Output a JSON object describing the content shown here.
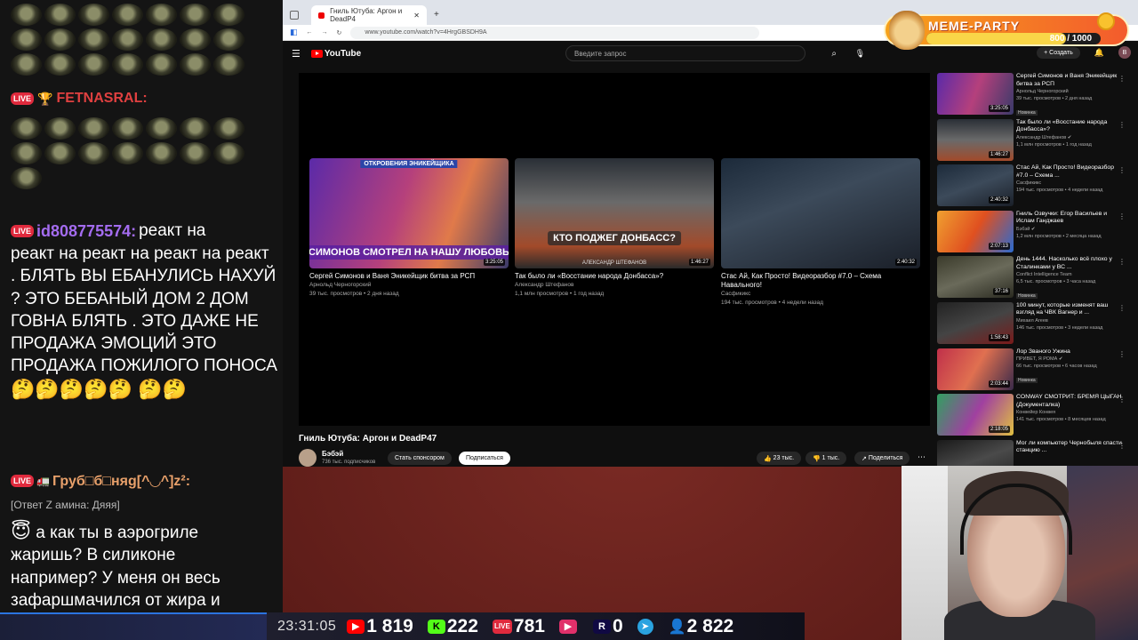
{
  "chat": {
    "messages": [
      {
        "user": "FETNASRAL:",
        "badge": "LIVE"
      },
      {
        "user": "id808775574:",
        "badge": "LIVE",
        "text_first": " реакт на",
        "text": "реакт на реакт на реакт на реакт . БЛЯТЬ ВЫ ЕБАНУЛИСЬ НАХУЙ ? ЭТО БЕБАНЫЙ ДОМ 2 ДОМ ГОВНА БЛЯТЬ . ЭТО ДАЖЕ НЕ ПРОДАЖА ЭМОЦИЙ ЭТО ПРОДАЖА ПОЖИЛОГО ПОНОСА"
      },
      {
        "user": "Груб□б□няg[^◡^]z²:",
        "badge": "LIVE",
        "reply_ref": "[Ответ Z амина: Дяяя]",
        "text": "а как ты в аэрогриле жаришь? В силиконе например? У меня он весь зафаршмачился от жира и пятна неотмываемые"
      }
    ]
  },
  "browser": {
    "tab_title": "Гниль Ютуба: Аргон и DeadP4",
    "url": "www.youtube.com/watch?v=4HrgGBSDH9A",
    "yt": {
      "logo": "YouTube",
      "search_placeholder": "Введите запрос",
      "create_label": "Создать",
      "avatar_letter": "В"
    },
    "endscreen": [
      {
        "title": "Сергей Симонов и Ваня Эникейщик битва за РСП",
        "channel": "Арнольд Черногорский",
        "meta": "39 тыс. просмотров • 2 дня назад",
        "duration": "3:25:05",
        "overlay_top": "ОТКРОВЕНИЯ ЭНИКЕЙЩИКА",
        "overlay": "СИМОНОВ СМОТРЕЛ НА НАШУ ЛЮБОВЬ"
      },
      {
        "title": "Так было ли «Восстание народа Донбасса»?",
        "channel": "Александр Штефанов",
        "meta": "1,1 млн просмотров • 1 год назад",
        "duration": "1:46:27",
        "overlay": "КТО ПОДЖЕГ ДОНБАСС?",
        "overlay_bottom": "АЛЕКСАНДР ШТЕФАНОВ"
      },
      {
        "title": "Стас Ай, Как Просто! Видеоразбор #7.0 – Схема Навального!",
        "channel": "Сасфикикс",
        "meta": "194 тыс. просмотров • 4 недели назад",
        "duration": "2:40:32"
      }
    ],
    "video": {
      "title": "Гниль Ютуба: Аргон и DeadP47",
      "channel": "Бэбэй",
      "subs": "736 тыс. подписчиков",
      "sponsor_label": "Стать спонсором",
      "subscribe_label": "Подписаться",
      "likes": "23 тыс.",
      "dislikes": "1 тыс.",
      "share_label": "Поделиться"
    },
    "sidebar": [
      {
        "title": "Сергей Симонов и Ваня Эникейщик битва за РСП",
        "channel": "Арнольд Черногорский",
        "views": "39 тыс. просмотров • 2 дня назад",
        "duration": "3:25:05",
        "badge": "Новинка"
      },
      {
        "title": "Так было ли «Восстание народа Донбасса»?",
        "channel": "Александр Штефанов ✔",
        "views": "1,1 млн просмотров • 1 год назад",
        "duration": "1:46:27"
      },
      {
        "title": "Стас Ай, Как Просто! Видеоразбор #7.0 – Схема ...",
        "channel": "Сасфикикс",
        "views": "194 тыс. просмотров • 4 недели назад",
        "duration": "2:40:32"
      },
      {
        "title": "Гниль Озвучки: Егор Васильев и Ислам Ганджаев",
        "channel": "Бэбэй ✔",
        "views": "1,2 млн просмотров • 2 месяца назад",
        "duration": "2:07:13"
      },
      {
        "title": "День 1444. Насколько всё плохо у Сталинками у ВС ...",
        "channel": "Conflict Intelligence Team",
        "views": "6,5 тыс. просмотров • 3 часа назад",
        "duration": "37:16",
        "badge": "Новинка"
      },
      {
        "title": "100 минут, которые изменят ваш взгляд на ЧВК Вагнер и ...",
        "channel": "Михаил Агеев",
        "views": "146 тыс. просмотров • 3 недели назад",
        "duration": "1:58:43"
      },
      {
        "title": "Лор Званого Ужина",
        "channel": "ПРИВЕТ, Я РОМА ✔",
        "views": "66 тыс. просмотров • 6 часов назад",
        "duration": "2:03:44",
        "badge": "Новинка"
      },
      {
        "title": "CONWAY СМОТРИТ: БРЕМЯ ЦЫГАН (Документалка)",
        "channel": "Конвейер Конвея",
        "views": "141 тыс. просмотров • 8 месяцев назад",
        "duration": "2:18:05"
      },
      {
        "title": "Мог ли компьютер Чернобыля спасти станцию ...",
        "channel": "",
        "views": "",
        "duration": ""
      }
    ]
  },
  "meme_party": {
    "title": "MEME-PARTY",
    "count": "800 / 1000",
    "progress": 0.8
  },
  "stats": {
    "time": "23:31:05",
    "youtube": "1 819",
    "kick": "222",
    "vklive": "781",
    "rutube": "0",
    "telegram": "",
    "viewers": "2 822"
  },
  "colors": {
    "youtube_red": "#ff0000",
    "kick_green": "#53fc18",
    "live_red": "#e02a3d",
    "telegram_blue": "#2aa3e0",
    "meme_orange": "#f7a21a"
  }
}
